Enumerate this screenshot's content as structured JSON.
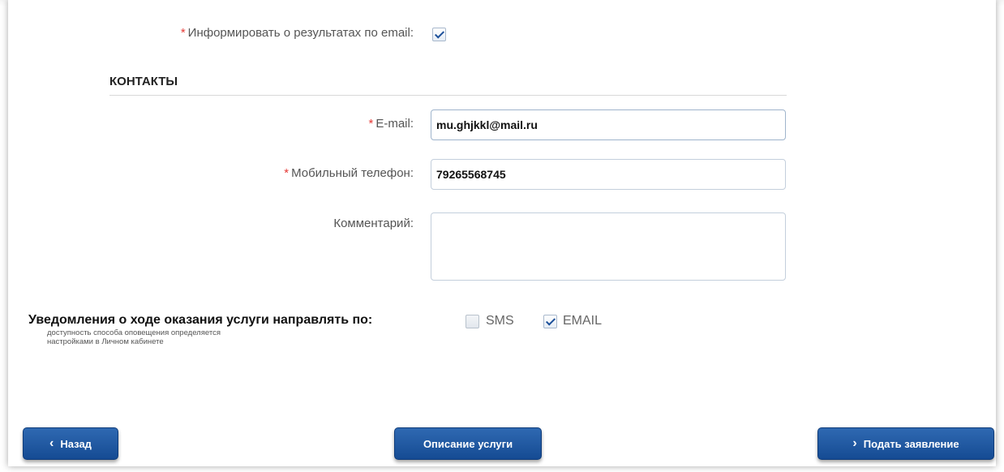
{
  "form": {
    "inform_email": {
      "required_mark": "*",
      "label": "Информировать о результатах по email:",
      "checked": true
    },
    "contacts_title": "КОНТАКТЫ",
    "email": {
      "required_mark": "*",
      "label": "E-mail:",
      "value": "mu.ghjkkl@mail.ru"
    },
    "phone": {
      "required_mark": "*",
      "label": "Мобильный телефон:",
      "value": "79265568745"
    },
    "comment": {
      "label": "Комментарий:",
      "value": ""
    }
  },
  "notifications": {
    "title": "Уведомления о ходе оказания услуги направлять по:",
    "subtitle_line1": "доступность способа оповещения определяется",
    "subtitle_line2": "настройками в Личном кабинете",
    "options": [
      {
        "label": "SMS",
        "checked": false
      },
      {
        "label": "EMAIL",
        "checked": true
      }
    ]
  },
  "buttons": {
    "back": {
      "label": "Назад",
      "icon": "chevron-left-icon"
    },
    "description": {
      "label": "Описание услуги"
    },
    "submit": {
      "label": "Подать заявление",
      "icon": "chevron-right-icon"
    }
  },
  "colors": {
    "primary": "#1d56a2",
    "required": "#e53935"
  }
}
